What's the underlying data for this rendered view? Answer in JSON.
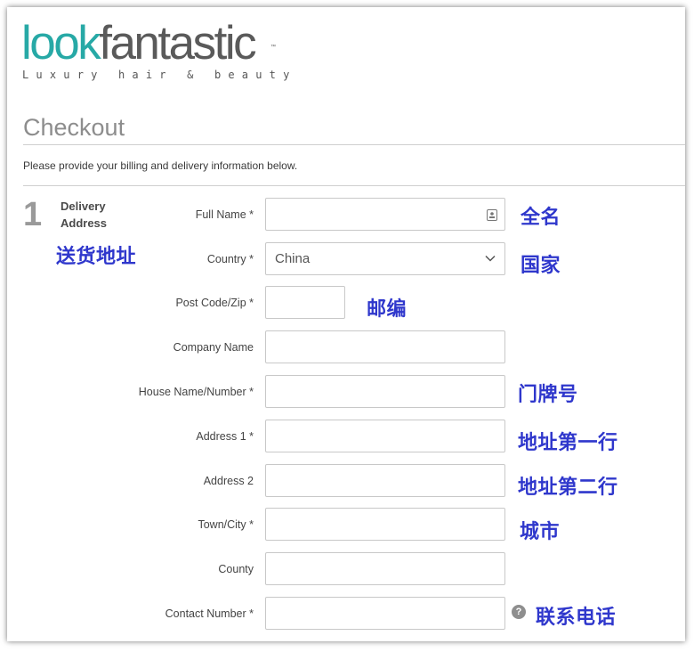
{
  "logo": {
    "part1": "look",
    "part2": "fantastic",
    "tm": "™",
    "tagline": "Luxury hair & beauty"
  },
  "page": {
    "title": "Checkout",
    "intro": "Please provide your billing and delivery information below."
  },
  "section": {
    "number": "1",
    "label": "Delivery Address",
    "annotation": "送货地址"
  },
  "form": {
    "full_name": {
      "label": "Full Name *",
      "value": "",
      "annotation": "全名"
    },
    "country": {
      "label": "Country *",
      "value": "China",
      "annotation": "国家"
    },
    "post_code": {
      "label": "Post Code/Zip *",
      "value": "",
      "annotation": "邮编"
    },
    "company": {
      "label": "Company Name",
      "value": ""
    },
    "house": {
      "label": "House Name/Number *",
      "value": "",
      "annotation": "门牌号"
    },
    "address1": {
      "label": "Address 1 *",
      "value": "",
      "annotation": "地址第一行"
    },
    "address2": {
      "label": "Address 2",
      "value": "",
      "annotation": "地址第二行"
    },
    "town": {
      "label": "Town/City *",
      "value": "",
      "annotation": "城市"
    },
    "county": {
      "label": "County",
      "value": ""
    },
    "contact": {
      "label": "Contact Number *",
      "value": "",
      "annotation": "联系电话"
    }
  },
  "icons": {
    "help": "?"
  },
  "colors": {
    "brand_teal": "#27a9a6",
    "annotation_blue": "#2f37cc",
    "title_grey": "#8d8d8d"
  }
}
